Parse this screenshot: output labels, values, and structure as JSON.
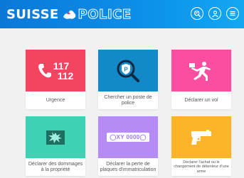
{
  "header": {
    "logo_swiss": "SUISSE",
    "logo_police": "POLICE",
    "icons": [
      "police-badge-icon",
      "user-icon",
      "menu-icon"
    ],
    "color": "#0b8ee8"
  },
  "tiles": [
    {
      "label": "Urgence",
      "color": "#f4445f",
      "art": {
        "line1": "117",
        "line2": "112"
      },
      "icon": "phone-icon"
    },
    {
      "label": "Chercher un poste de police",
      "color": "#1489c8",
      "icon": "search-police-icon"
    },
    {
      "label": "Déclarer un vol",
      "color": "#fc4ea1",
      "icon": "thief-running-icon"
    },
    {
      "label": "Déclarer des dommages à la propriété",
      "color": "#3fd1b4",
      "icon": "broken-glass-icon"
    },
    {
      "label": "Déclarer la perte de plaques d'immatriculation",
      "color": "#b58cf4",
      "icon": "license-plate-icon",
      "plate_text": "XY 0000"
    },
    {
      "label": "Declarer l'achat ou le changement de détenteur d'une arme",
      "color": "#fcb529",
      "icon": "gun-icon"
    }
  ]
}
